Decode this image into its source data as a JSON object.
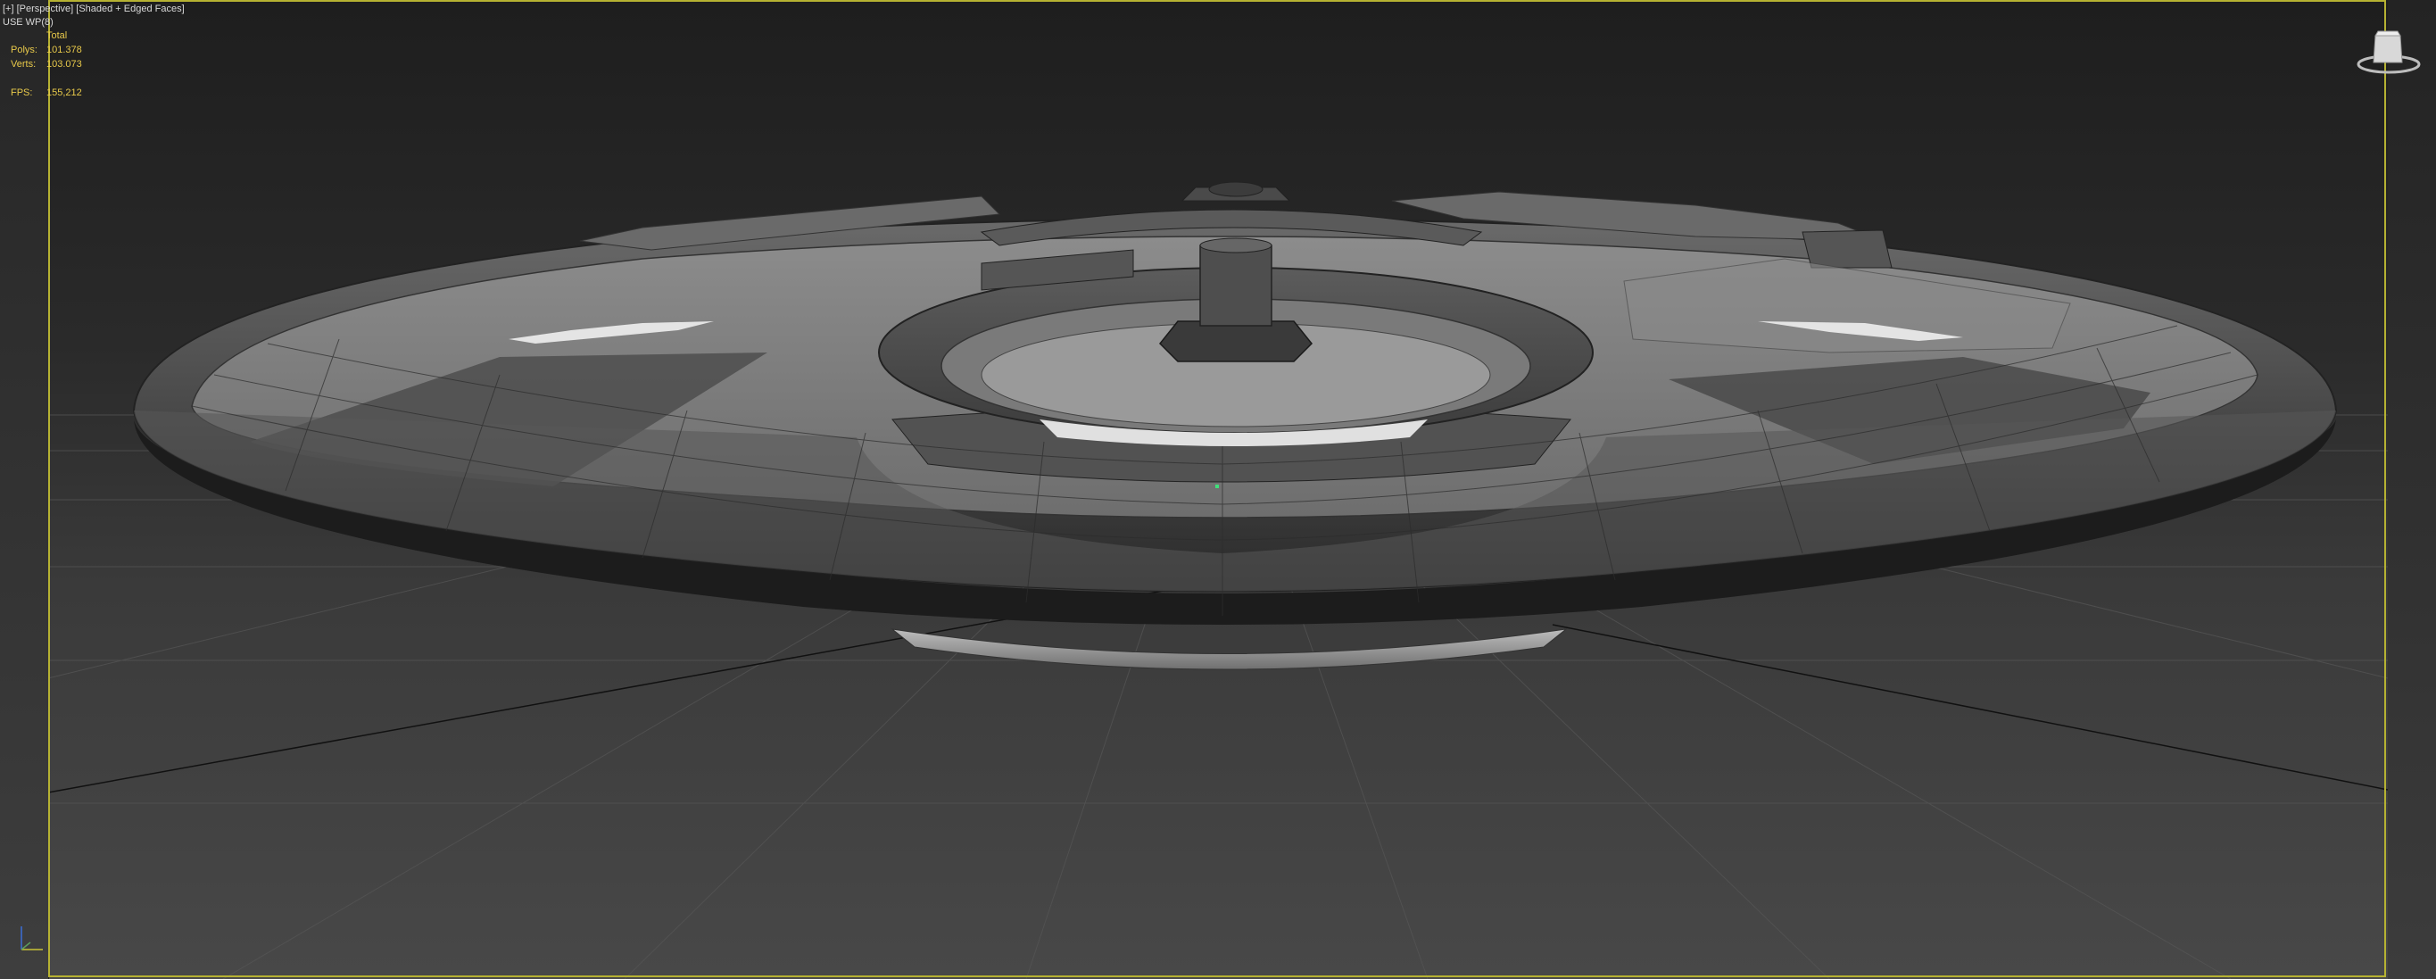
{
  "viewport": {
    "menu": {
      "plus": "[+]",
      "view": "[Perspective]",
      "shading": "[Shaded + Edged Faces]"
    },
    "use_wp": "USE WP(8)",
    "stats": {
      "header": "Total",
      "polys_label": "Polys:",
      "polys_value": "101.378",
      "verts_label": "Verts:",
      "verts_value": "103.073",
      "fps_label": "FPS:",
      "fps_value": "155,212"
    }
  },
  "icons": {
    "viewcube": "viewcube-icon",
    "axis": "axis-tripod-icon"
  },
  "colors": {
    "frame": "#b6b232",
    "stats": "#e8c94a",
    "label": "#d8d8d8"
  }
}
